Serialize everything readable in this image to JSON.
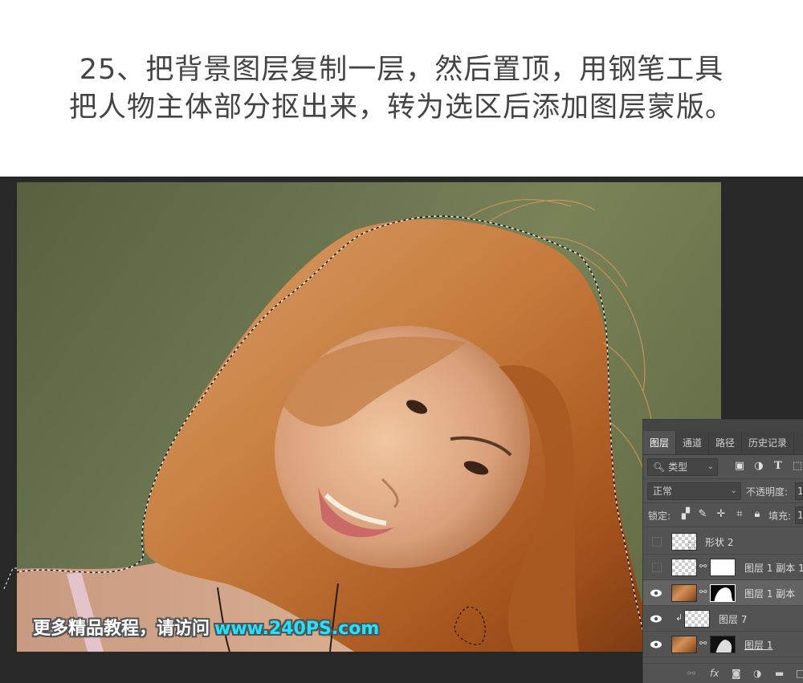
{
  "caption": {
    "line1": "25、把背景图层复制一层，然后置顶，用钢笔工具",
    "line2": "把人物主体部分抠出来，转为选区后添加图层蒙版。"
  },
  "watermark": {
    "text": "更多精品教程，请访问",
    "url": "www.240PS.com"
  },
  "colors": {
    "background_canvas": "#6b7550",
    "workspace": "#282828",
    "panel": "#535353",
    "watermark_url": "#22e3ff"
  },
  "layers_panel": {
    "tabs": [
      {
        "label": "图层",
        "active": true
      },
      {
        "label": "通道",
        "active": false
      },
      {
        "label": "路径",
        "active": false
      },
      {
        "label": "历史记录",
        "active": false
      }
    ],
    "filter": {
      "icon": "search-icon",
      "value": "类型",
      "filter_icons": [
        "image-icon",
        "adjustment-icon",
        "type-icon",
        "shape-icon"
      ]
    },
    "blend_mode": "正常",
    "opacity_label": "不透明度:",
    "opacity_value": "1",
    "lock_label": "锁定:",
    "lock_icons": [
      "lock-transparent-icon",
      "lock-brush-icon",
      "lock-move-icon",
      "lock-artboard-icon",
      "lock-all-icon"
    ],
    "fill_label": "填充:",
    "fill_value": "1",
    "layers": [
      {
        "name": "形状 2",
        "visible": false,
        "thumb": "shape",
        "mask": false,
        "selected": false
      },
      {
        "name": "图层 1 副本 1",
        "visible": false,
        "thumb": "transparent",
        "mask": "white",
        "selected": false
      },
      {
        "name": "图层 1 副本",
        "visible": true,
        "thumb": "photo",
        "mask": "silhouette",
        "selected": true
      },
      {
        "name": "图层 7",
        "visible": true,
        "thumb": "transparent",
        "mask": false,
        "selected": false,
        "clipped": true
      },
      {
        "name": "图层 1",
        "visible": true,
        "thumb": "photo",
        "mask": "hair-mask",
        "selected": false
      }
    ],
    "footer_icons": [
      "link-icon",
      "fx-icon",
      "add-mask-icon",
      "adjustment-layer-icon",
      "group-folder-icon",
      "new-layer-icon"
    ]
  }
}
